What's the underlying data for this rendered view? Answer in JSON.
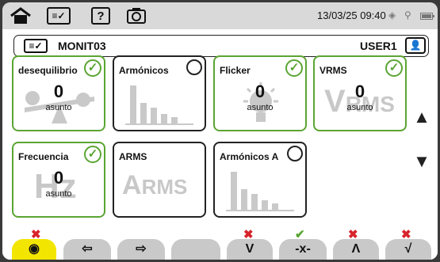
{
  "topbar": {
    "datetime": "13/03/25 09:40",
    "icons": [
      "home-icon",
      "list-check-icon",
      "help-icon",
      "camera-icon",
      "gps-icon",
      "usb-network-icon",
      "battery-icon"
    ],
    "help_label": "?"
  },
  "header": {
    "title": "MONIT03",
    "user": "USER1"
  },
  "tiles": [
    {
      "label": "desequilibrio",
      "value": "0",
      "unit": "asunto",
      "checked": true
    },
    {
      "label": "Armónicos",
      "value": "",
      "unit": "",
      "checked": false
    },
    {
      "label": "Flicker",
      "value": "0",
      "unit": "asunto",
      "checked": true
    },
    {
      "label": "VRMS",
      "value": "0",
      "unit": "asunto",
      "checked": true,
      "bg": "VRMS"
    },
    {
      "label": "Frecuencia",
      "value": "0",
      "unit": "asunto",
      "checked": true,
      "bg": "Hz"
    },
    {
      "label": "ARMS",
      "value": "",
      "unit": "",
      "checked": false,
      "bg": "ARMS"
    },
    {
      "label": "Armónicos A",
      "value": "",
      "unit": "",
      "checked": false
    }
  ],
  "toolbar": {
    "buttons": [
      {
        "icon": "view-icon",
        "glyph": "◉",
        "status": "x",
        "selected": true
      },
      {
        "icon": "import-icon",
        "glyph": "⇦",
        "status": "",
        "selected": false
      },
      {
        "icon": "export-icon",
        "glyph": "⇨",
        "status": "",
        "selected": false
      },
      {
        "icon": "blank-icon",
        "glyph": "",
        "status": "",
        "selected": false
      },
      {
        "icon": "dip-icon",
        "glyph": "V",
        "status": "x",
        "selected": false
      },
      {
        "icon": "interruption-icon",
        "glyph": "-x-",
        "status": "ok",
        "selected": false
      },
      {
        "icon": "swell-icon",
        "glyph": "Λ",
        "status": "x",
        "selected": false
      },
      {
        "icon": "transient-icon",
        "glyph": "√",
        "status": "x",
        "selected": false
      }
    ],
    "marks": {
      "x": "✖",
      "ok": "✔"
    }
  },
  "colors": {
    "active_border": "#5aa532",
    "selected_button": "#f2e600",
    "error": "#d8232a"
  }
}
